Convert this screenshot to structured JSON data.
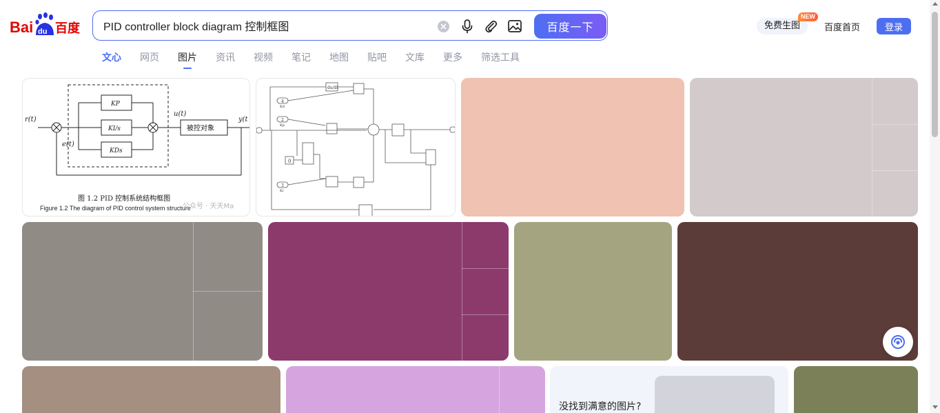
{
  "logo": {
    "bai": "Bai",
    "du": "du",
    "cn": "百度"
  },
  "search": {
    "query": "PID controller block diagram 控制框图",
    "submit_label": "百度一下"
  },
  "header": {
    "gen_label": "免费生图",
    "new_badge": "NEW",
    "home_label": "百度首页",
    "login_label": "登录"
  },
  "tabs": [
    {
      "label": "文心"
    },
    {
      "label": "网页"
    },
    {
      "label": "图片"
    },
    {
      "label": "资讯"
    },
    {
      "label": "视频"
    },
    {
      "label": "笔记"
    },
    {
      "label": "地图"
    },
    {
      "label": "贴吧"
    },
    {
      "label": "文库"
    },
    {
      "label": "更多"
    },
    {
      "label": "筛选工具"
    }
  ],
  "result1": {
    "r": "r(t)",
    "e": "e(t)",
    "u": "u(t)",
    "y": "y(t",
    "kp": "KP",
    "ki": "KI/s",
    "kd": "KDs",
    "plant": "被控对象",
    "caption_cn": "图 1.2 PID 控制系统结构框图",
    "caption_en": "Figure 1.2 The diagram of PID control system structure",
    "watermark": "公众号 · 天天Ma"
  },
  "result2": {
    "block_du": "du/dt",
    "port4": "4",
    "port4_label": "Kd",
    "port2": "2",
    "port2_label": "Kp",
    "port3": "3",
    "port3_label": "Ki",
    "const0": "0"
  },
  "tile_colors": {
    "r1c3": "#efc2b1",
    "r1c4": "#d2cacb",
    "r2c1": "#918b86",
    "r2c2": "#8c3a6c",
    "r2c3": "#a4a480",
    "r2c4": "#5c3c39",
    "r3c1": "#a48f80",
    "r3c2": "#d6a5e0",
    "r3c4": "#7b8058"
  },
  "no_result": {
    "text": "没找到满意的图片?"
  }
}
